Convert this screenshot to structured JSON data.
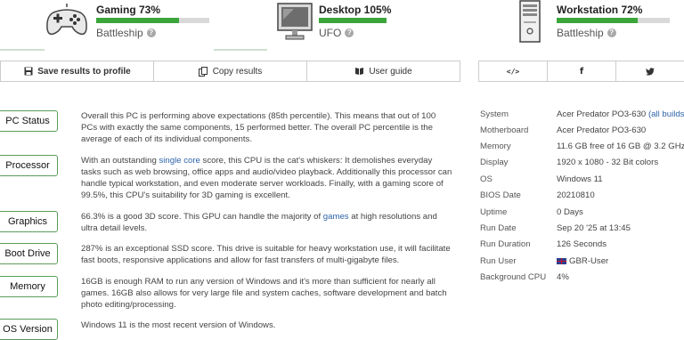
{
  "banners": [
    {
      "title": "Gaming 73%",
      "value_percent": 73,
      "sub": "Battleship",
      "icon": "gamepad-icon",
      "bar_color": "#3aa63a"
    },
    {
      "title": "Desktop 105%",
      "value_percent": 100,
      "sub": "UFO",
      "icon": "monitor-icon",
      "bar_color": "#3aa63a"
    },
    {
      "title": "Workstation 72%",
      "value_percent": 72,
      "sub": "Battleship",
      "icon": "tower-pc-icon",
      "bar_color": "#3aa63a"
    }
  ],
  "toolbar": {
    "save_label": "Save results to profile",
    "copy_label": "Copy results",
    "guide_label": "User guide",
    "share_embed_icon": "code-icon",
    "share_facebook_icon": "facebook-icon",
    "share_twitter_icon": "twitter-icon"
  },
  "sections": [
    {
      "label": "PC Status"
    },
    {
      "label": "Processor"
    },
    {
      "label": "Graphics"
    },
    {
      "label": "Boot Drive"
    },
    {
      "label": "Memory"
    },
    {
      "label": "OS Version"
    }
  ],
  "paragraphs": {
    "pc_status": "Overall this PC is performing above expectations (85th percentile). This means that out of 100 PCs with exactly the same components, 15 performed better. The overall PC percentile is the average of each of its individual components.",
    "processor_pre": "With an outstanding ",
    "processor_link": "single core",
    "processor_post": " score, this CPU is the cat's whiskers: It demolishes everyday tasks such as web browsing, office apps and audio/video playback. Additionally this processor can handle typical workstation, and even moderate server workloads. Finally, with a gaming score of 99.5%, this CPU's suitability for 3D gaming is excellent.",
    "graphics_pre": "66.3% is a good 3D score. This GPU can handle the majority of ",
    "graphics_link": "games",
    "graphics_post": " at high resolutions and ultra detail levels.",
    "boot_drive": "287% is an exceptional SSD score. This drive is suitable for heavy workstation use, it will facilitate fast boots, responsive applications and allow for fast transfers of multi-gigabyte files.",
    "memory": "16GB is enough RAM to run any version of Windows and it's more than sufficient for nearly all games. 16GB also allows for very large file and system caches, software development and batch photo editing/processing.",
    "os_version": "Windows 11 is the most recent version of Windows."
  },
  "system": [
    {
      "key": "System",
      "value": "Acer Predator PO3-630",
      "link": "(all builds)"
    },
    {
      "key": "Motherboard",
      "value": "Acer Predator PO3-630"
    },
    {
      "key": "Memory",
      "value": "11.6 GB free of 16 GB @ 3.2 GHz"
    },
    {
      "key": "Display",
      "value": "1920 x 1080 - 32 Bit colors"
    },
    {
      "key": "OS",
      "value": "Windows 11"
    },
    {
      "key": "BIOS Date",
      "value": "20210810"
    },
    {
      "key": "Uptime",
      "value": "0 Days"
    },
    {
      "key": "Run Date",
      "value": "Sep 20 '25 at 13:45"
    },
    {
      "key": "Run Duration",
      "value": "126 Seconds"
    },
    {
      "key": "Run User",
      "value": "GBR-User",
      "icon": "uk-flag-icon"
    },
    {
      "key": "Background CPU",
      "value": "4%"
    }
  ],
  "colors": {
    "accent_green": "#3aa63a",
    "tag_border": "#5a9d5a",
    "link_blue": "#2f64a8"
  }
}
